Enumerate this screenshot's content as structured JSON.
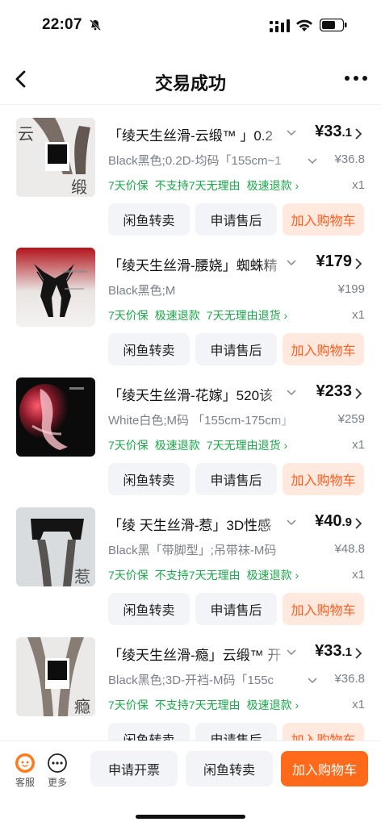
{
  "status_bar": {
    "time": "22:07"
  },
  "nav": {
    "title": "交易成功"
  },
  "items": [
    {
      "title": "「绫天生丝滑-云缎™ 」0.2",
      "price_main": "¥33",
      "price_dec": ".1",
      "spec": "Black黑色;0.2D-均码「155cm~1",
      "orig_price": "¥36.8",
      "tags": [
        "7天价保",
        "不支持7天无理由",
        "极速退款 ›"
      ],
      "qty": "x1",
      "thumb_char_top": "云",
      "thumb_char_bottom": "缎",
      "buttons": [
        "闲鱼转卖",
        "申请售后",
        "加入购物车"
      ]
    },
    {
      "title": "「绫天生丝滑-腰娆」蜘蛛精",
      "price_main": "¥179",
      "price_dec": "",
      "spec": "Black黑色;M",
      "orig_price": "¥199",
      "tags": [
        "7天价保",
        "极速退款",
        "7天无理由退货 ›"
      ],
      "qty": "x1",
      "thumb_char_top": "",
      "thumb_char_bottom": "",
      "buttons": [
        "闲鱼转卖",
        "申请售后",
        "加入购物车"
      ]
    },
    {
      "title": "「绫天生丝滑-花嫁」520该",
      "price_main": "¥233",
      "price_dec": "",
      "spec": "White白色;M码 「155cm-175cm」",
      "orig_price": "¥259",
      "tags": [
        "7天价保",
        "极速退款",
        "7天无理由退货 ›"
      ],
      "qty": "x1",
      "thumb_char_top": "",
      "thumb_char_bottom": "",
      "buttons": [
        "闲鱼转卖",
        "申请售后",
        "加入购物车"
      ]
    },
    {
      "title": "「绫 天生丝滑-惹」3D性感",
      "price_main": "¥40",
      "price_dec": ".9",
      "spec": "Black黑「带脚型」;吊带袜-M码",
      "orig_price": "¥48.8",
      "tags": [
        "7天价保",
        "不支持7天无理由",
        "极速退款 ›"
      ],
      "qty": "x1",
      "thumb_char_top": "",
      "thumb_char_bottom": "惹",
      "buttons": [
        "闲鱼转卖",
        "申请售后",
        "加入购物车"
      ]
    },
    {
      "title": "「绫天生丝滑-瘾」云缎™ 开",
      "price_main": "¥33",
      "price_dec": ".1",
      "spec": "Black黑色;3D-开裆-M码「155c",
      "orig_price": "¥36.8",
      "tags": [
        "7天价保",
        "不支持7天无理由",
        "极速退款 ›"
      ],
      "qty": "x1",
      "thumb_char_top": "",
      "thumb_char_bottom": "瘾",
      "buttons": [
        "闲鱼转卖",
        "申请售后",
        "加入购物车"
      ]
    }
  ],
  "bottom_bar": {
    "service_label": "客服",
    "more_label": "更多",
    "invoice_button": "申请开票",
    "resell_button": "闲鱼转卖",
    "cart_button": "加入购物车"
  },
  "colors": {
    "accent_orange": "#ff6a1a",
    "orange_light": "#ffe9de",
    "tag_green": "#1aaa4a",
    "secondary_text": "#7b7f8a"
  }
}
